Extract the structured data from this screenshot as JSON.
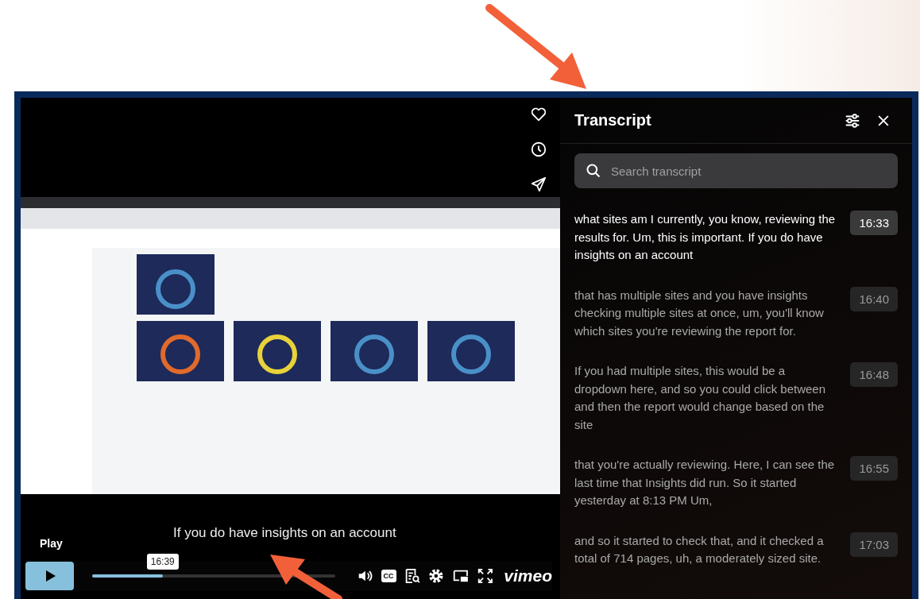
{
  "video": {
    "kind": "picture",
    "playing": false,
    "caption": "If you do have insights on an account",
    "play_tooltip": "Play",
    "time_tooltip": "16:39",
    "progress": {
      "level": 0.29
    },
    "cc_label": "CC",
    "brand": "vimeo"
  },
  "transcript": {
    "title": "Transcript",
    "search": {
      "placeholder": "Search transcript"
    },
    "entries": [
      {
        "text": "what sites am I currently, you know, reviewing the results for. Um, this is important. If you do have insights on an account",
        "time": "16:33",
        "selected": true
      },
      {
        "text": "that has multiple sites and you have insights checking multiple sites at once, um, you'll know which sites you're reviewing the report for.",
        "time": "16:40",
        "selected": false
      },
      {
        "text": "If you had multiple sites, this would be a dropdown here, and so you could click between and then the report would change based on the site",
        "time": "16:48",
        "selected": false
      },
      {
        "text": "that you're actually reviewing. Here, I can see the last time that Insights did run. So it started yesterday at 8:13 PM Um,",
        "time": "16:55",
        "selected": false
      },
      {
        "text": "and so it started to check that, and it checked a total of 714 pages, uh, a moderately sized site.",
        "time": "17:03",
        "selected": false
      }
    ]
  }
}
